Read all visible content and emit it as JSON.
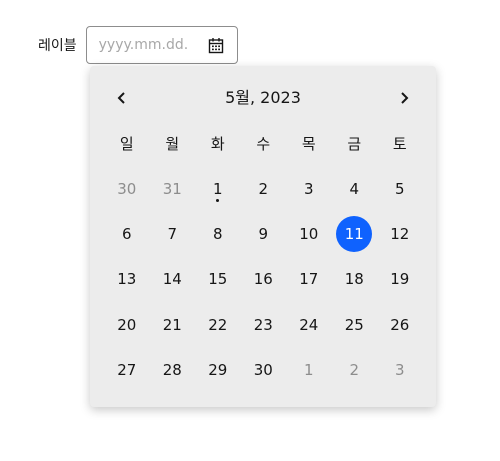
{
  "field": {
    "label": "레이블",
    "placeholder": "yyyy.mm.dd.",
    "value": ""
  },
  "calendar": {
    "month_title": "5월, 2023",
    "weekdays": [
      "일",
      "월",
      "화",
      "수",
      "목",
      "금",
      "토"
    ],
    "days": [
      {
        "label": "30",
        "other": true
      },
      {
        "label": "31",
        "other": true
      },
      {
        "label": "1",
        "today": true
      },
      {
        "label": "2"
      },
      {
        "label": "3"
      },
      {
        "label": "4"
      },
      {
        "label": "5"
      },
      {
        "label": "6"
      },
      {
        "label": "7"
      },
      {
        "label": "8"
      },
      {
        "label": "9"
      },
      {
        "label": "10"
      },
      {
        "label": "11",
        "selected": true
      },
      {
        "label": "12"
      },
      {
        "label": "13"
      },
      {
        "label": "14"
      },
      {
        "label": "15"
      },
      {
        "label": "16"
      },
      {
        "label": "17"
      },
      {
        "label": "18"
      },
      {
        "label": "19"
      },
      {
        "label": "20"
      },
      {
        "label": "21"
      },
      {
        "label": "22"
      },
      {
        "label": "23"
      },
      {
        "label": "24"
      },
      {
        "label": "25"
      },
      {
        "label": "26"
      },
      {
        "label": "27"
      },
      {
        "label": "28"
      },
      {
        "label": "29"
      },
      {
        "label": "30"
      },
      {
        "label": "1",
        "other": true
      },
      {
        "label": "2",
        "other": true
      },
      {
        "label": "3",
        "other": true
      }
    ]
  },
  "icons": {
    "field_icon": "calendar-icon",
    "prev": "chevron-left-icon",
    "next": "chevron-right-icon"
  },
  "colors": {
    "accent": "#0f62fe",
    "popup_bg": "#ececec",
    "muted_text": "#8d8d8d"
  }
}
